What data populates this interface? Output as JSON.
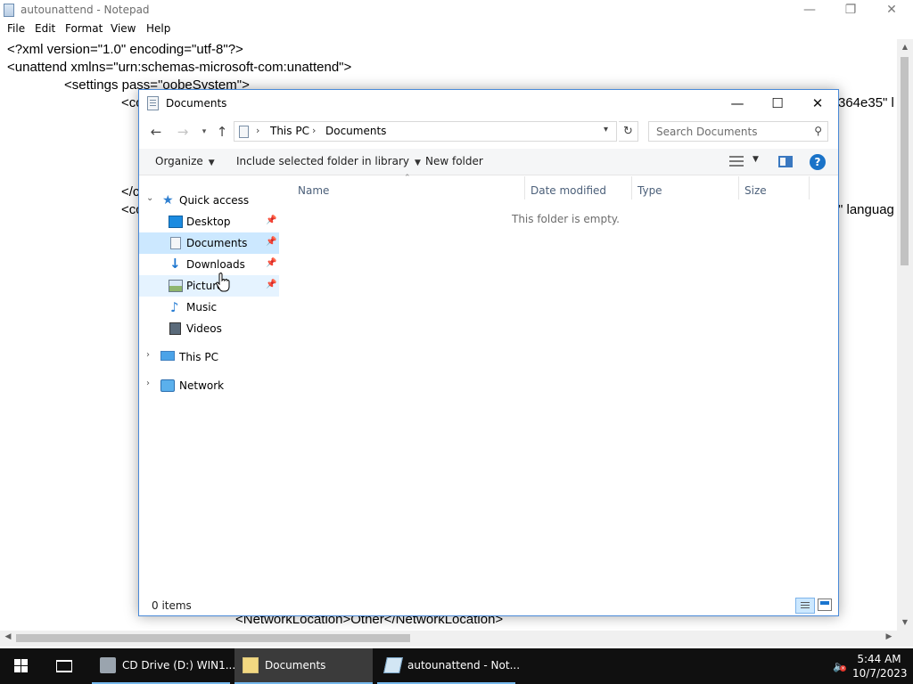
{
  "notepad": {
    "title": "autounattend - Notepad",
    "menu": [
      "File",
      "Edit",
      "Format",
      "View",
      "Help"
    ],
    "lines": [
      "<?xml version=\"1.0\" encoding=\"utf-8\"?>",
      "<unattend xmlns=\"urn:schemas-microsoft-com:unattend\">",
      "<settings pass=\"oobeSystem\">",
      "<cc",
      "364e35\" l",
      "</c",
      "<cc",
      "\" languag",
      "<NetworkLocation>Other</NetworkLocation>"
    ]
  },
  "dialog": {
    "title": "Documents",
    "breadcrumb": [
      "This PC",
      "Documents"
    ],
    "search_placeholder": "Search Documents",
    "commands": {
      "organize": "Organize",
      "include": "Include selected folder in library",
      "new_folder": "New folder"
    },
    "nav": {
      "quick_access": "Quick access",
      "items": [
        "Desktop",
        "Documents",
        "Downloads",
        "Pictures",
        "Music",
        "Videos"
      ],
      "this_pc": "This PC",
      "network": "Network"
    },
    "columns": [
      "Name",
      "Date modified",
      "Type",
      "Size"
    ],
    "empty_message": "This folder is empty.",
    "status": "0 items"
  },
  "taskbar": {
    "items": [
      "CD Drive (D:) WIN1...",
      "Documents",
      "autounattend - Not..."
    ],
    "time": "5:44 AM",
    "date": "10/7/2023"
  }
}
